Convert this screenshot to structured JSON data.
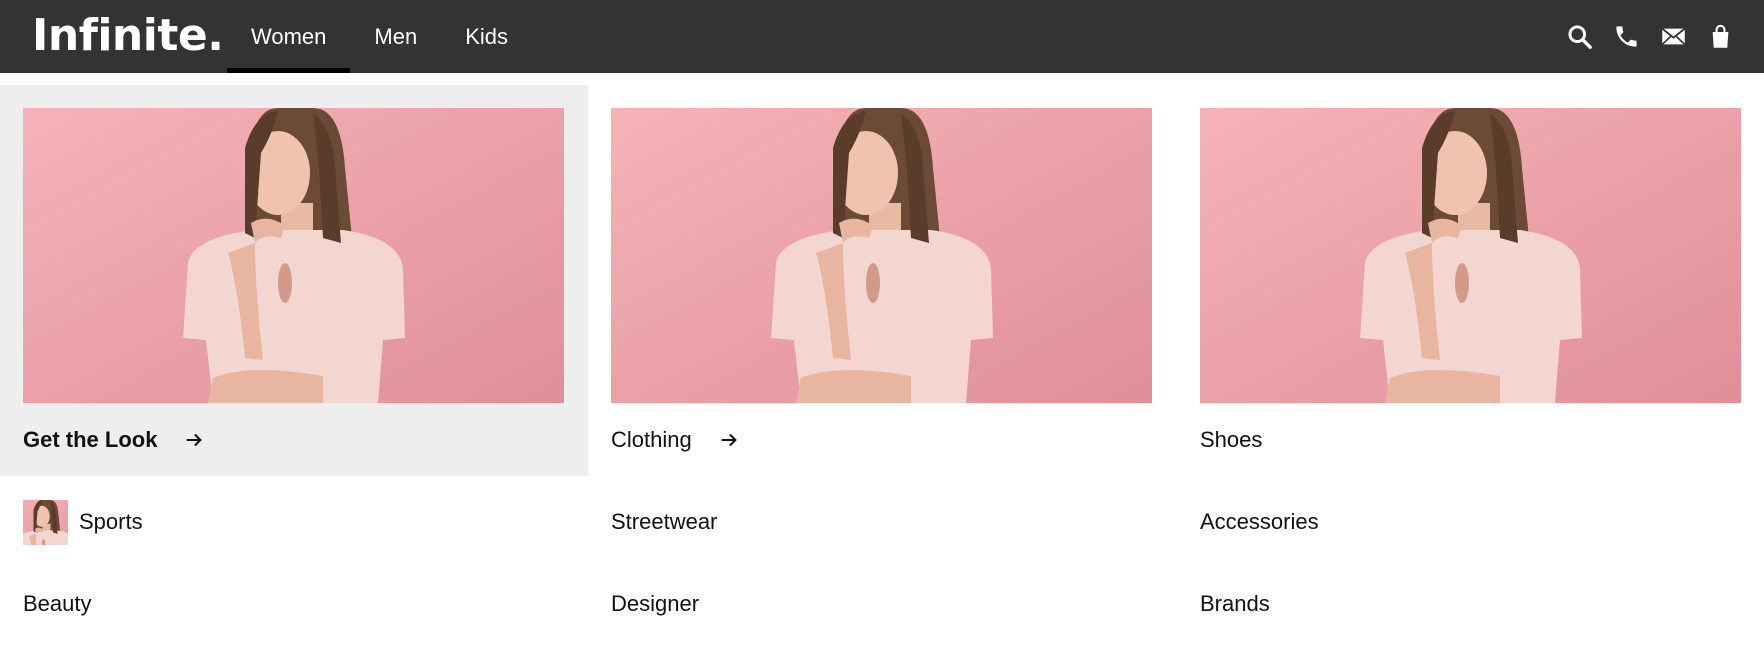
{
  "header": {
    "logo": "Infinite.",
    "nav": [
      {
        "label": "Women",
        "active": true
      },
      {
        "label": "Men",
        "active": false
      },
      {
        "label": "Kids",
        "active": false
      }
    ],
    "icons": [
      "search-icon",
      "phone-icon",
      "mail-icon",
      "shopping-bag-icon"
    ],
    "background": "#333333",
    "active_underline": "#000000"
  },
  "menu": {
    "highlight_background": "#eeeeee",
    "featured": [
      {
        "label": "Get the Look",
        "arrow": true,
        "bold": true
      },
      {
        "label": "Clothing",
        "arrow": true,
        "bold": false
      },
      {
        "label": "Shoes",
        "arrow": false,
        "bold": false
      }
    ],
    "links": {
      "col1": [
        "Sports",
        "Beauty"
      ],
      "col2": [
        "Streetwear",
        "Designer"
      ],
      "col3": [
        "Accessories",
        "Brands"
      ]
    }
  }
}
